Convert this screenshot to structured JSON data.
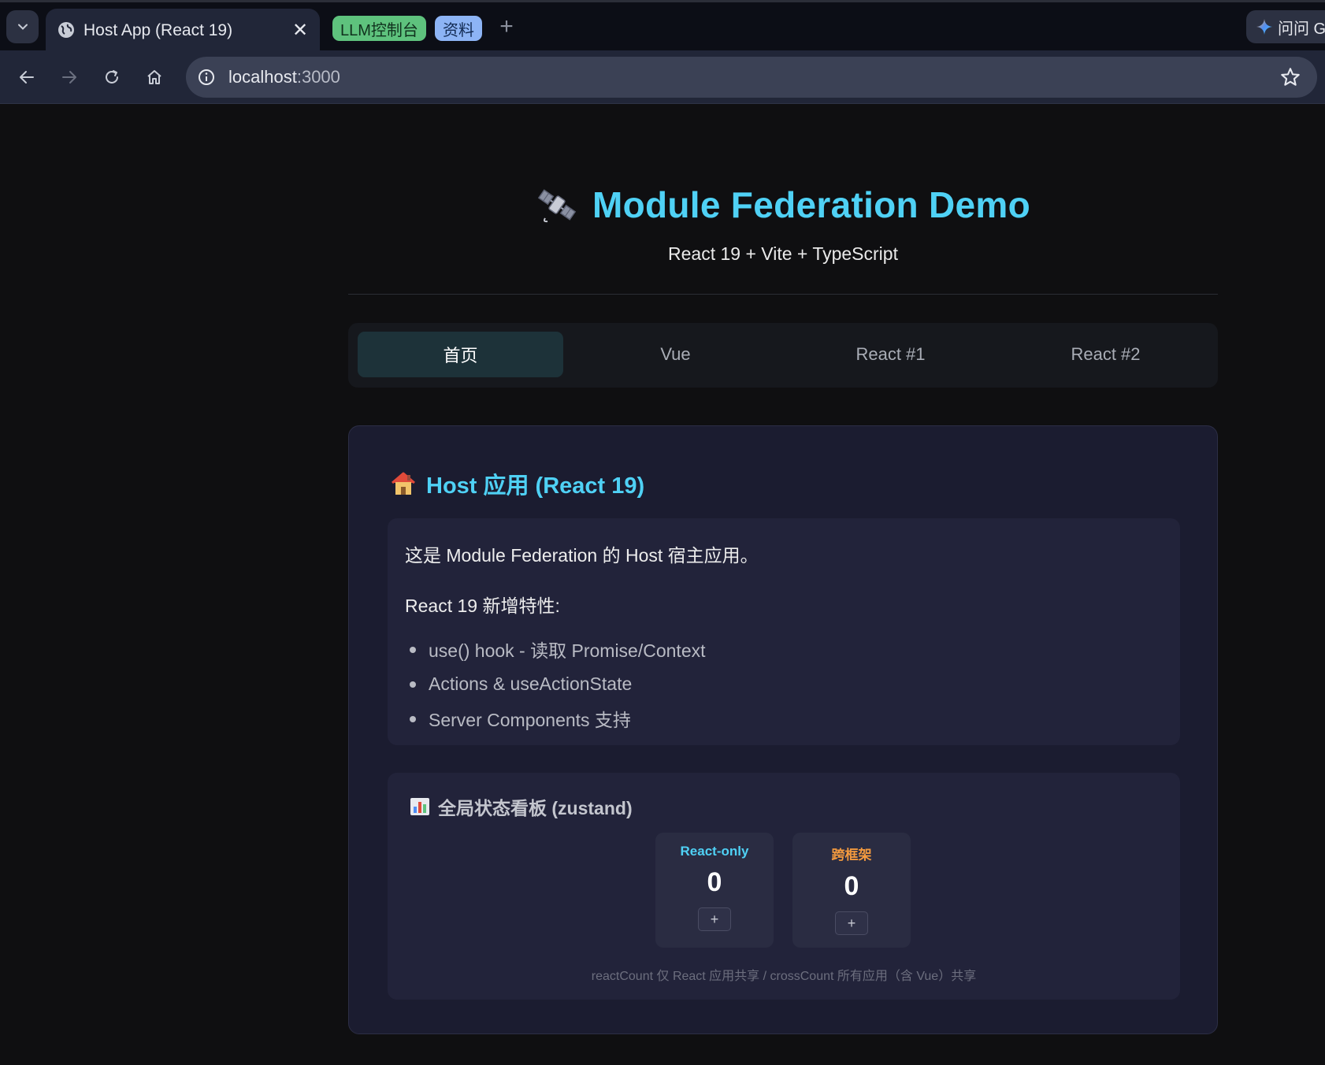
{
  "browser": {
    "tab_title": "Host App (React 19)",
    "tab_close": "✕",
    "chips": {
      "llm": "LLM控制台",
      "ziliao": "资料"
    },
    "new_tab": "+",
    "ask_label": "问问 G",
    "url_host": "localhost",
    "url_port": ":3000"
  },
  "header": {
    "title": "Module Federation Demo",
    "subtitle": "React 19 + Vite + TypeScript"
  },
  "nav": {
    "tabs": [
      {
        "label": "首页",
        "active": true
      },
      {
        "label": "Vue",
        "active": false
      },
      {
        "label": "React #1",
        "active": false
      },
      {
        "label": "React #2",
        "active": false
      }
    ]
  },
  "host_card": {
    "title": "Host 应用 (React 19)",
    "intro": "这是 Module Federation 的 Host 宿主应用。",
    "features_heading": "React 19 新增特性:",
    "features": [
      "use() hook - 读取 Promise/Context",
      "Actions & useActionState",
      "Server Components 支持"
    ]
  },
  "state_board": {
    "title": "全局状态看板 (zustand)",
    "react_only": {
      "label": "React-only",
      "value": "0",
      "button": "+"
    },
    "cross": {
      "label": "跨框架",
      "value": "0",
      "button": "+"
    },
    "note": "reactCount 仅 React 应用共享 / crossCount 所有应用（含 Vue）共享"
  },
  "colors": {
    "accent": "#4fd1f5",
    "cross_accent": "#f39a3f",
    "card_bg": "#1b1c30",
    "active_tab_bg": "#1d3239"
  },
  "icons": {
    "title": "satellite-icon",
    "card": "house-icon",
    "state": "bar-chart-icon",
    "ask": "sparkle-icon"
  }
}
